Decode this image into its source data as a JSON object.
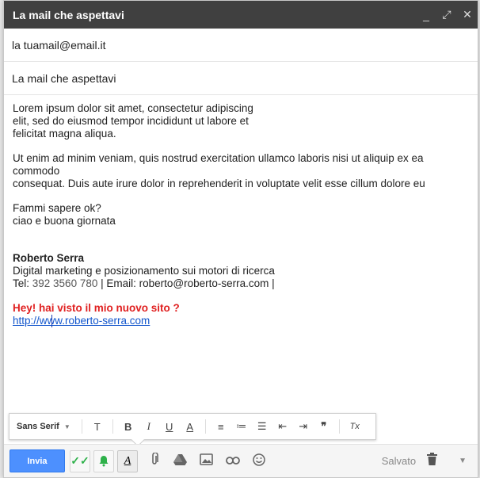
{
  "window": {
    "title": "La mail che aspettavi",
    "minimize": "_",
    "expand": "⤢",
    "close": "✕"
  },
  "compose": {
    "to": "la tuamail@email.it",
    "subject": "La mail che aspettavi",
    "body": {
      "p1_l1": "Lorem ipsum dolor sit amet, consectetur adipiscing",
      "p1_l2": "elit, sed do eiusmod tempor incididunt ut labore et",
      "p1_l3": "felicitat magna aliqua.",
      "p2_l1": "Ut enim ad minim veniam, quis nostrud exercitation ullamco laboris nisi ut aliquip ex ea commodo",
      "p2_l2": "consequat. Duis aute irure dolor in reprehenderit in voluptate velit esse cillum dolore eu",
      "p3_l1": "Fammi sapere ok?",
      "p3_l2": "ciao e buona giornata"
    },
    "signature": {
      "name": "Roberto Serra",
      "role": "Digital marketing e posizionamento sui motori di ricerca",
      "tel_label": "Tel: ",
      "tel": "392 3560 780",
      "sep1": " | ",
      "email_label": "Email: roberto@roberto-serra.com |",
      "hey": "Hey! hai visto il mio nuovo sito ?",
      "url": "http://www.roberto-serra.com"
    }
  },
  "format_bar": {
    "font": "Sans Serif",
    "icons": {
      "size": "T",
      "bold": "B",
      "italic": "I",
      "underline": "U",
      "text_color": "A",
      "align": "≡",
      "numbered": "≔",
      "bulleted": "☰",
      "indent_less": "⇤",
      "indent_more": "⇥",
      "quote": "❞",
      "clear": "Tx"
    }
  },
  "bottom_bar": {
    "send": "Invia",
    "saved": "Salvato"
  },
  "colors": {
    "send_blue": "#4d90fe",
    "hey_red": "#e02020",
    "link_blue": "#1155cc",
    "titlebar": "#404040"
  }
}
